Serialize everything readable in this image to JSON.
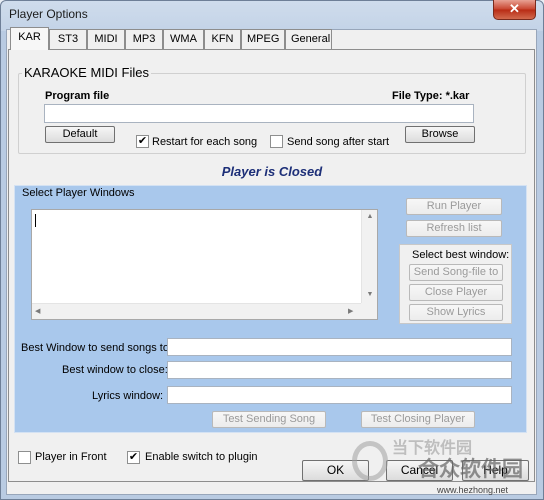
{
  "window": {
    "title": "Player Options",
    "close_glyph": "✕"
  },
  "tabs": [
    {
      "label": "KAR",
      "active": true
    },
    {
      "label": "ST3"
    },
    {
      "label": "MIDI"
    },
    {
      "label": "MP3"
    },
    {
      "label": "WMA"
    },
    {
      "label": "KFN"
    },
    {
      "label": "MPEG"
    },
    {
      "label": "General"
    }
  ],
  "kar_group": {
    "title": "KARAOKE MIDI Files",
    "program_file_label": "Program file",
    "file_type_label": "File Type: *.kar",
    "program_file_value": "",
    "default_button": "Default",
    "restart_label": "Restart for each song",
    "restart_checked": true,
    "send_after_start_label": "Send song after start",
    "send_after_start_checked": false,
    "browse_button": "Browse"
  },
  "status_text": "Player is Closed",
  "player_windows": {
    "title": "Select Player Windows",
    "run_player_button": "Run Player",
    "refresh_list_button": "Refresh list",
    "best_window_title": "Select best window:",
    "send_song_file_button": "Send Song-file to",
    "close_player_button": "Close Player",
    "show_lyrics_button": "Show Lyrics",
    "best_send_label": "Best Window to send songs to:",
    "best_close_label": "Best window to close:",
    "lyrics_label": "Lyrics window:",
    "best_send_value": "",
    "best_close_value": "",
    "lyrics_value": "",
    "test_sending_button": "Test Sending Song",
    "test_closing_button": "Test Closing Player"
  },
  "bottom": {
    "player_front_label": "Player in Front",
    "player_front_checked": false,
    "enable_switch_label": "Enable switch to plugin",
    "enable_switch_checked": true,
    "ok_button": "OK",
    "cancel_button": "Cancel",
    "help_button": "Help"
  },
  "watermark": {
    "line1": "当下软件园",
    "line2": "合众软件园",
    "url": "www.hezhong.net"
  },
  "colors": {
    "status_text": "#1d2f78",
    "panel_blue": "#a9c8ec",
    "titlebar": "#c3d3e7"
  }
}
